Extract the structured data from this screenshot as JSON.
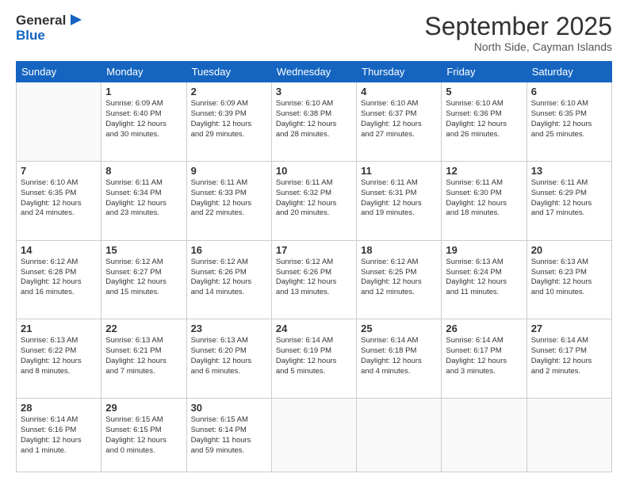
{
  "header": {
    "logo_line1": "General",
    "logo_line2": "Blue",
    "month": "September 2025",
    "location": "North Side, Cayman Islands"
  },
  "weekdays": [
    "Sunday",
    "Monday",
    "Tuesday",
    "Wednesday",
    "Thursday",
    "Friday",
    "Saturday"
  ],
  "weeks": [
    [
      {
        "day": "",
        "info": ""
      },
      {
        "day": "1",
        "info": "Sunrise: 6:09 AM\nSunset: 6:40 PM\nDaylight: 12 hours\nand 30 minutes."
      },
      {
        "day": "2",
        "info": "Sunrise: 6:09 AM\nSunset: 6:39 PM\nDaylight: 12 hours\nand 29 minutes."
      },
      {
        "day": "3",
        "info": "Sunrise: 6:10 AM\nSunset: 6:38 PM\nDaylight: 12 hours\nand 28 minutes."
      },
      {
        "day": "4",
        "info": "Sunrise: 6:10 AM\nSunset: 6:37 PM\nDaylight: 12 hours\nand 27 minutes."
      },
      {
        "day": "5",
        "info": "Sunrise: 6:10 AM\nSunset: 6:36 PM\nDaylight: 12 hours\nand 26 minutes."
      },
      {
        "day": "6",
        "info": "Sunrise: 6:10 AM\nSunset: 6:35 PM\nDaylight: 12 hours\nand 25 minutes."
      }
    ],
    [
      {
        "day": "7",
        "info": "Sunrise: 6:10 AM\nSunset: 6:35 PM\nDaylight: 12 hours\nand 24 minutes."
      },
      {
        "day": "8",
        "info": "Sunrise: 6:11 AM\nSunset: 6:34 PM\nDaylight: 12 hours\nand 23 minutes."
      },
      {
        "day": "9",
        "info": "Sunrise: 6:11 AM\nSunset: 6:33 PM\nDaylight: 12 hours\nand 22 minutes."
      },
      {
        "day": "10",
        "info": "Sunrise: 6:11 AM\nSunset: 6:32 PM\nDaylight: 12 hours\nand 20 minutes."
      },
      {
        "day": "11",
        "info": "Sunrise: 6:11 AM\nSunset: 6:31 PM\nDaylight: 12 hours\nand 19 minutes."
      },
      {
        "day": "12",
        "info": "Sunrise: 6:11 AM\nSunset: 6:30 PM\nDaylight: 12 hours\nand 18 minutes."
      },
      {
        "day": "13",
        "info": "Sunrise: 6:11 AM\nSunset: 6:29 PM\nDaylight: 12 hours\nand 17 minutes."
      }
    ],
    [
      {
        "day": "14",
        "info": "Sunrise: 6:12 AM\nSunset: 6:28 PM\nDaylight: 12 hours\nand 16 minutes."
      },
      {
        "day": "15",
        "info": "Sunrise: 6:12 AM\nSunset: 6:27 PM\nDaylight: 12 hours\nand 15 minutes."
      },
      {
        "day": "16",
        "info": "Sunrise: 6:12 AM\nSunset: 6:26 PM\nDaylight: 12 hours\nand 14 minutes."
      },
      {
        "day": "17",
        "info": "Sunrise: 6:12 AM\nSunset: 6:26 PM\nDaylight: 12 hours\nand 13 minutes."
      },
      {
        "day": "18",
        "info": "Sunrise: 6:12 AM\nSunset: 6:25 PM\nDaylight: 12 hours\nand 12 minutes."
      },
      {
        "day": "19",
        "info": "Sunrise: 6:13 AM\nSunset: 6:24 PM\nDaylight: 12 hours\nand 11 minutes."
      },
      {
        "day": "20",
        "info": "Sunrise: 6:13 AM\nSunset: 6:23 PM\nDaylight: 12 hours\nand 10 minutes."
      }
    ],
    [
      {
        "day": "21",
        "info": "Sunrise: 6:13 AM\nSunset: 6:22 PM\nDaylight: 12 hours\nand 8 minutes."
      },
      {
        "day": "22",
        "info": "Sunrise: 6:13 AM\nSunset: 6:21 PM\nDaylight: 12 hours\nand 7 minutes."
      },
      {
        "day": "23",
        "info": "Sunrise: 6:13 AM\nSunset: 6:20 PM\nDaylight: 12 hours\nand 6 minutes."
      },
      {
        "day": "24",
        "info": "Sunrise: 6:14 AM\nSunset: 6:19 PM\nDaylight: 12 hours\nand 5 minutes."
      },
      {
        "day": "25",
        "info": "Sunrise: 6:14 AM\nSunset: 6:18 PM\nDaylight: 12 hours\nand 4 minutes."
      },
      {
        "day": "26",
        "info": "Sunrise: 6:14 AM\nSunset: 6:17 PM\nDaylight: 12 hours\nand 3 minutes."
      },
      {
        "day": "27",
        "info": "Sunrise: 6:14 AM\nSunset: 6:17 PM\nDaylight: 12 hours\nand 2 minutes."
      }
    ],
    [
      {
        "day": "28",
        "info": "Sunrise: 6:14 AM\nSunset: 6:16 PM\nDaylight: 12 hours\nand 1 minute."
      },
      {
        "day": "29",
        "info": "Sunrise: 6:15 AM\nSunset: 6:15 PM\nDaylight: 12 hours\nand 0 minutes."
      },
      {
        "day": "30",
        "info": "Sunrise: 6:15 AM\nSunset: 6:14 PM\nDaylight: 11 hours\nand 59 minutes."
      },
      {
        "day": "",
        "info": ""
      },
      {
        "day": "",
        "info": ""
      },
      {
        "day": "",
        "info": ""
      },
      {
        "day": "",
        "info": ""
      }
    ]
  ]
}
